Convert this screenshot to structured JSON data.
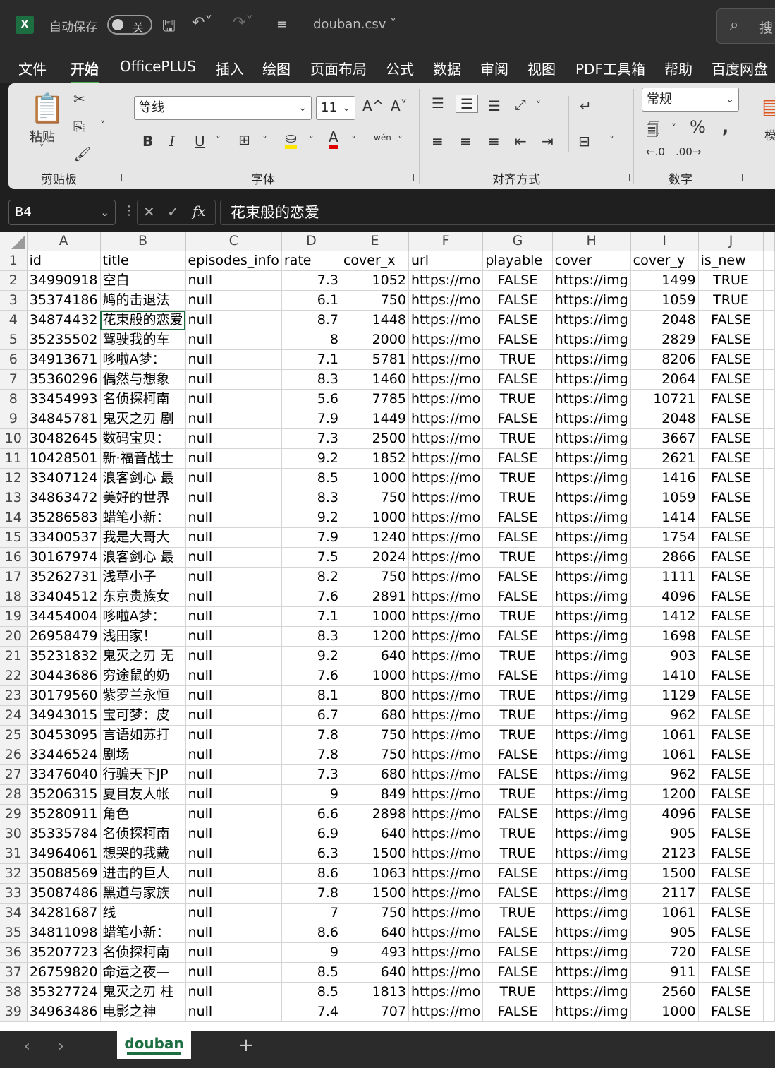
{
  "titlebar": {
    "app_icon": "excel-logo",
    "app_letter": "X",
    "autosave_label": "自动保存",
    "autosave_state": "关",
    "document_title": "douban.csv",
    "search_placeholder": "搜"
  },
  "menu": [
    "文件",
    "开始",
    "OfficePLUS",
    "插入",
    "绘图",
    "页面布局",
    "公式",
    "数据",
    "审阅",
    "视图",
    "PDF工具箱",
    "帮助",
    "百度网盘"
  ],
  "menu_active": "开始",
  "ribbon": {
    "clipboard": {
      "paste_label": "粘贴",
      "group_label": "剪贴板"
    },
    "font": {
      "font_name": "等线",
      "font_size": "11",
      "group_label": "字体",
      "bold": "B",
      "italic": "I",
      "underline": "U",
      "grow": "A^",
      "shrink": "A˅",
      "phonetic": "wén"
    },
    "alignment": {
      "group_label": "对齐方式"
    },
    "number": {
      "format": "常规",
      "group_label": "数字"
    },
    "overflow_label": "模"
  },
  "formula_bar": {
    "name_box": "B4",
    "fx_label": "fx",
    "formula": "花束般的恋爱"
  },
  "grid": {
    "col_letters": [
      "A",
      "B",
      "C",
      "D",
      "E",
      "F",
      "G",
      "H",
      "I",
      "J"
    ],
    "headers": [
      "id",
      "title",
      "episodes_info",
      "rate",
      "cover_x",
      "url",
      "playable",
      "cover",
      "cover_y",
      "is_new"
    ],
    "rows": [
      [
        "34990918",
        "空白",
        "null",
        "7.3",
        "1052",
        "https://mo",
        "FALSE",
        "https://img",
        "1499",
        "TRUE"
      ],
      [
        "35374186",
        "鸠的击退法",
        "null",
        "6.1",
        "750",
        "https://mo",
        "FALSE",
        "https://img",
        "1059",
        "TRUE"
      ],
      [
        "34874432",
        "花束般的恋爱",
        "null",
        "8.7",
        "1448",
        "https://mo",
        "FALSE",
        "https://img",
        "2048",
        "FALSE"
      ],
      [
        "35235502",
        "驾驶我的车",
        "null",
        "8",
        "2000",
        "https://mo",
        "FALSE",
        "https://img",
        "2829",
        "FALSE"
      ],
      [
        "34913671",
        "哆啦A梦：",
        "null",
        "7.1",
        "5781",
        "https://mo",
        "TRUE",
        "https://img",
        "8206",
        "FALSE"
      ],
      [
        "35360296",
        "偶然与想象",
        "null",
        "8.3",
        "1460",
        "https://mo",
        "FALSE",
        "https://img",
        "2064",
        "FALSE"
      ],
      [
        "33454993",
        "名侦探柯南",
        "null",
        "5.6",
        "7785",
        "https://mo",
        "TRUE",
        "https://img",
        "10721",
        "FALSE"
      ],
      [
        "34845781",
        "鬼灭之刃 剧",
        "null",
        "7.9",
        "1449",
        "https://mo",
        "FALSE",
        "https://img",
        "2048",
        "FALSE"
      ],
      [
        "30482645",
        "数码宝贝：",
        "null",
        "7.3",
        "2500",
        "https://mo",
        "TRUE",
        "https://img",
        "3667",
        "FALSE"
      ],
      [
        "10428501",
        "新·福音战士",
        "null",
        "9.2",
        "1852",
        "https://mo",
        "FALSE",
        "https://img",
        "2621",
        "FALSE"
      ],
      [
        "33407124",
        "浪客剑心 最",
        "null",
        "8.5",
        "1000",
        "https://mo",
        "TRUE",
        "https://img",
        "1416",
        "FALSE"
      ],
      [
        "34863472",
        "美好的世界",
        "null",
        "8.3",
        "750",
        "https://mo",
        "TRUE",
        "https://img",
        "1059",
        "FALSE"
      ],
      [
        "35286583",
        "蜡笔小新：",
        "null",
        "9.2",
        "1000",
        "https://mo",
        "FALSE",
        "https://img",
        "1414",
        "FALSE"
      ],
      [
        "33400537",
        "我是大哥大",
        "null",
        "7.9",
        "1240",
        "https://mo",
        "FALSE",
        "https://img",
        "1754",
        "FALSE"
      ],
      [
        "30167974",
        "浪客剑心 最",
        "null",
        "7.5",
        "2024",
        "https://mo",
        "TRUE",
        "https://img",
        "2866",
        "FALSE"
      ],
      [
        "35262731",
        "浅草小子",
        "null",
        "8.2",
        "750",
        "https://mo",
        "FALSE",
        "https://img",
        "1111",
        "FALSE"
      ],
      [
        "33404512",
        "东京贵族女",
        "null",
        "7.6",
        "2891",
        "https://mo",
        "FALSE",
        "https://img",
        "4096",
        "FALSE"
      ],
      [
        "34454004",
        "哆啦A梦：",
        "null",
        "7.1",
        "1000",
        "https://mo",
        "TRUE",
        "https://img",
        "1412",
        "FALSE"
      ],
      [
        "26958479",
        "浅田家！",
        "null",
        "8.3",
        "1200",
        "https://mo",
        "FALSE",
        "https://img",
        "1698",
        "FALSE"
      ],
      [
        "35231832",
        "鬼灭之刃 无",
        "null",
        "9.2",
        "640",
        "https://mo",
        "TRUE",
        "https://img",
        "903",
        "FALSE"
      ],
      [
        "30443686",
        "穷途鼠的奶",
        "null",
        "7.6",
        "1000",
        "https://mo",
        "FALSE",
        "https://img",
        "1410",
        "FALSE"
      ],
      [
        "30179560",
        "紫罗兰永恒",
        "null",
        "8.1",
        "800",
        "https://mo",
        "TRUE",
        "https://img",
        "1129",
        "FALSE"
      ],
      [
        "34943015",
        "宝可梦：皮",
        "null",
        "6.7",
        "680",
        "https://mo",
        "TRUE",
        "https://img",
        "962",
        "FALSE"
      ],
      [
        "30453095",
        "言语如苏打",
        "null",
        "7.8",
        "750",
        "https://mo",
        "TRUE",
        "https://img",
        "1061",
        "FALSE"
      ],
      [
        "33446524",
        "剧场",
        "null",
        "7.8",
        "750",
        "https://mo",
        "FALSE",
        "https://img",
        "1061",
        "FALSE"
      ],
      [
        "33476040",
        "行骗天下JP",
        "null",
        "7.3",
        "680",
        "https://mo",
        "FALSE",
        "https://img",
        "962",
        "FALSE"
      ],
      [
        "35206315",
        "夏目友人帐",
        "null",
        "9",
        "849",
        "https://mo",
        "TRUE",
        "https://img",
        "1200",
        "FALSE"
      ],
      [
        "35280911",
        "角色",
        "null",
        "6.6",
        "2898",
        "https://mo",
        "FALSE",
        "https://img",
        "4096",
        "FALSE"
      ],
      [
        "35335784",
        "名侦探柯南",
        "null",
        "6.9",
        "640",
        "https://mo",
        "TRUE",
        "https://img",
        "905",
        "FALSE"
      ],
      [
        "34964061",
        "想哭的我戴",
        "null",
        "6.3",
        "1500",
        "https://mo",
        "TRUE",
        "https://img",
        "2123",
        "FALSE"
      ],
      [
        "35088569",
        "进击的巨人",
        "null",
        "8.6",
        "1063",
        "https://mo",
        "FALSE",
        "https://img",
        "1500",
        "FALSE"
      ],
      [
        "35087486",
        "黑道与家族",
        "null",
        "7.8",
        "1500",
        "https://mo",
        "FALSE",
        "https://img",
        "2117",
        "FALSE"
      ],
      [
        "34281687",
        "线",
        "null",
        "7",
        "750",
        "https://mo",
        "TRUE",
        "https://img",
        "1061",
        "FALSE"
      ],
      [
        "34811098",
        "蜡笔小新：",
        "null",
        "8.6",
        "640",
        "https://mo",
        "FALSE",
        "https://img",
        "905",
        "FALSE"
      ],
      [
        "35207723",
        "名侦探柯南",
        "null",
        "9",
        "493",
        "https://mo",
        "FALSE",
        "https://img",
        "720",
        "FALSE"
      ],
      [
        "26759820",
        "命运之夜—",
        "null",
        "8.5",
        "640",
        "https://mo",
        "FALSE",
        "https://img",
        "911",
        "FALSE"
      ],
      [
        "35327724",
        "鬼灭之刃 柱",
        "null",
        "8.5",
        "1813",
        "https://mo",
        "TRUE",
        "https://img",
        "2560",
        "FALSE"
      ],
      [
        "34963486",
        "电影之神",
        "null",
        "7.4",
        "707",
        "https://mo",
        "FALSE",
        "https://img",
        "1000",
        "FALSE"
      ]
    ]
  },
  "sheets": {
    "active": "douban",
    "add_label": "+"
  }
}
